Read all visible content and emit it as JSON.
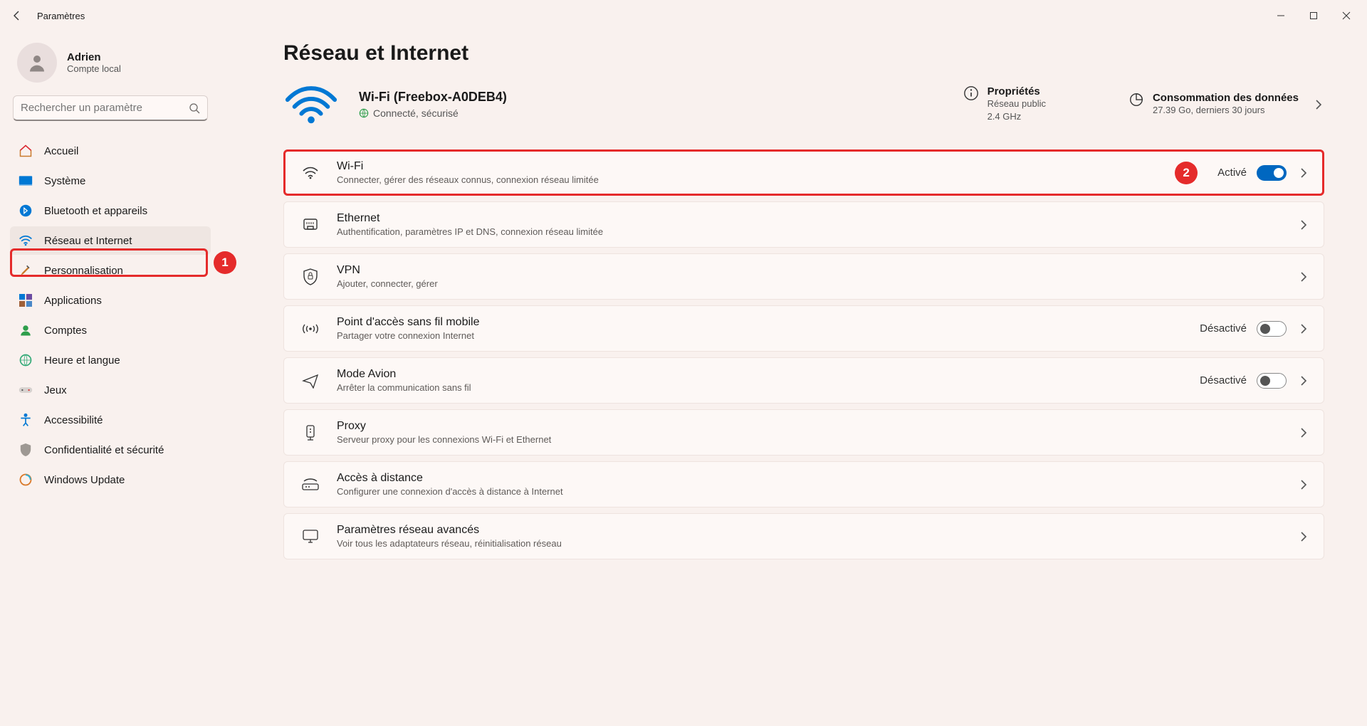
{
  "window": {
    "title": "Paramètres"
  },
  "user": {
    "name": "Adrien",
    "subtitle": "Compte local"
  },
  "search": {
    "placeholder": "Rechercher un paramètre"
  },
  "sidebar": {
    "items": [
      {
        "label": "Accueil"
      },
      {
        "label": "Système"
      },
      {
        "label": "Bluetooth et appareils"
      },
      {
        "label": "Réseau et Internet"
      },
      {
        "label": "Personnalisation"
      },
      {
        "label": "Applications"
      },
      {
        "label": "Comptes"
      },
      {
        "label": "Heure et langue"
      },
      {
        "label": "Jeux"
      },
      {
        "label": "Accessibilité"
      },
      {
        "label": "Confidentialité et sécurité"
      },
      {
        "label": "Windows Update"
      }
    ]
  },
  "annotations": {
    "badge1": "1",
    "badge2": "2"
  },
  "page": {
    "title": "Réseau et Internet",
    "status": {
      "ssid": "Wi-Fi (Freebox-A0DEB4)",
      "state": "Connecté, sécurisé",
      "properties_label": "Propriétés",
      "properties_line1": "Réseau public",
      "properties_line2": "2.4 GHz",
      "data_label": "Consommation des données",
      "data_sub": "27.39 Go, derniers 30 jours"
    },
    "rows": {
      "wifi": {
        "title": "Wi-Fi",
        "sub": "Connecter, gérer des réseaux connus, connexion réseau limitée",
        "state": "Activé"
      },
      "eth": {
        "title": "Ethernet",
        "sub": "Authentification, paramètres IP et DNS, connexion réseau limitée"
      },
      "vpn": {
        "title": "VPN",
        "sub": "Ajouter, connecter, gérer"
      },
      "hotspot": {
        "title": "Point d'accès sans fil mobile",
        "sub": "Partager votre connexion Internet",
        "state": "Désactivé"
      },
      "airplane": {
        "title": "Mode Avion",
        "sub": "Arrêter la communication sans fil",
        "state": "Désactivé"
      },
      "proxy": {
        "title": "Proxy",
        "sub": "Serveur proxy pour les connexions Wi-Fi et Ethernet"
      },
      "remote": {
        "title": "Accès à distance",
        "sub": "Configurer une connexion d'accès à distance à Internet"
      },
      "adv": {
        "title": "Paramètres réseau avancés",
        "sub": "Voir tous les adaptateurs réseau, réinitialisation réseau"
      }
    }
  }
}
